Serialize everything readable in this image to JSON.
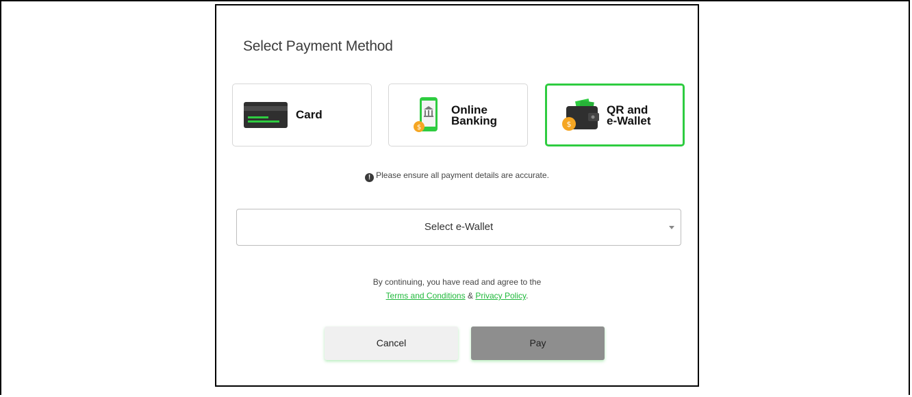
{
  "dialog": {
    "title": "Select Payment Method"
  },
  "methods": [
    {
      "id": "card",
      "label": "Card",
      "icon": "credit-card-icon",
      "selected": false
    },
    {
      "id": "online-banking",
      "label_line1": "Online",
      "label_line2": "Banking",
      "icon": "mobile-bank-icon",
      "selected": false
    },
    {
      "id": "qr-ewallet",
      "label_line1": "QR and",
      "label_line2": "e-Wallet",
      "icon": "wallet-icon",
      "selected": true
    }
  ],
  "notice": {
    "icon": "exclamation-circle-icon",
    "text": "Please ensure all payment details are accurate."
  },
  "ewallet_select": {
    "value": "Select e-Wallet"
  },
  "terms": {
    "line1": "By continuing, you have read and agree to the",
    "terms_link": "Terms and Conditions",
    "ampersand": "&",
    "privacy_link": "Privacy Policy",
    "end": "."
  },
  "buttons": {
    "cancel": "Cancel",
    "pay": "Pay"
  },
  "colors": {
    "accent_green": "#2ecc40",
    "link_green": "#1fb83a",
    "pay_disabled_gray": "#8e8e8e"
  }
}
